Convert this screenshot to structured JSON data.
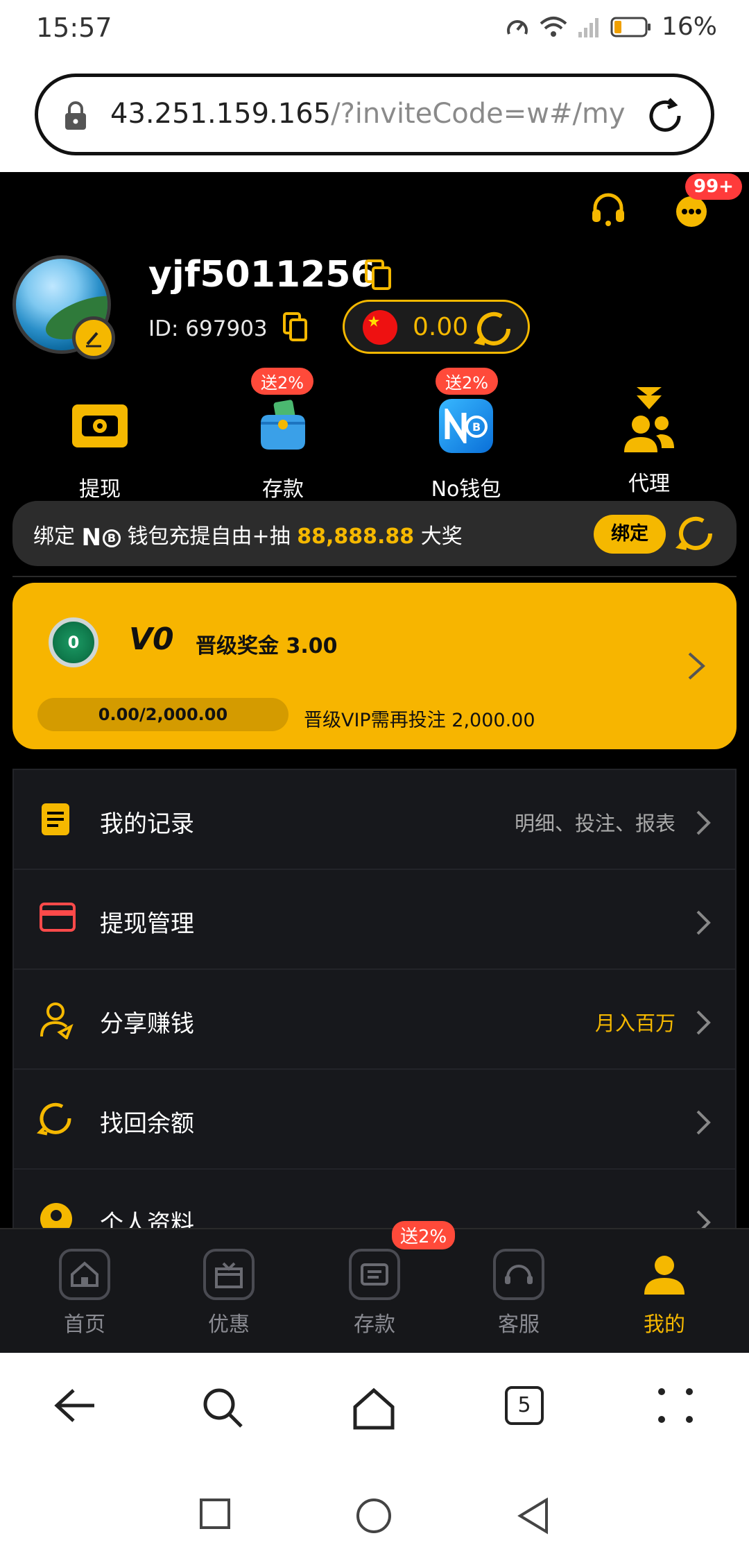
{
  "status": {
    "time": "15:57",
    "battery": "16%"
  },
  "browser": {
    "host": "43.251.159.165",
    "path": "/?inviteCode=w#/my",
    "tab_count": "5"
  },
  "header": {
    "notify_badge": "99+"
  },
  "profile": {
    "username": "yjf5011256",
    "id_text": "ID: 697903",
    "balance": "0.00"
  },
  "quick_actions": [
    {
      "label": "提现",
      "badge": ""
    },
    {
      "label": "存款",
      "badge": "送2%"
    },
    {
      "label": "No钱包",
      "badge": "送2%"
    },
    {
      "label": "代理",
      "badge": ""
    }
  ],
  "bind_banner": {
    "prefix": "绑定",
    "brand": "N",
    "middle": "钱包充提自由+抽",
    "amount": "88,888.88",
    "suffix": "大奖",
    "button": "绑定"
  },
  "vip": {
    "medal_level": "0",
    "level": "V0",
    "bonus": "晋级奖金 3.00",
    "progress_text": "0.00/2,000.00",
    "progress": 0,
    "need_text": "晋级VIP需再投注 2,000.00"
  },
  "menu": [
    {
      "label": "我的记录",
      "right": "明细、投注、报表"
    },
    {
      "label": "提现管理",
      "right": ""
    },
    {
      "label": "分享赚钱",
      "right": "月入百万"
    },
    {
      "label": "找回余额",
      "right": ""
    },
    {
      "label": "个人资料",
      "right": ""
    }
  ],
  "tabbar": {
    "badge": "送2%",
    "items": [
      "首页",
      "优惠",
      "存款",
      "客服",
      "我的"
    ]
  },
  "colors": {
    "accent": "#f5b800",
    "badge": "#ff4a3a",
    "bg": "#000000"
  }
}
